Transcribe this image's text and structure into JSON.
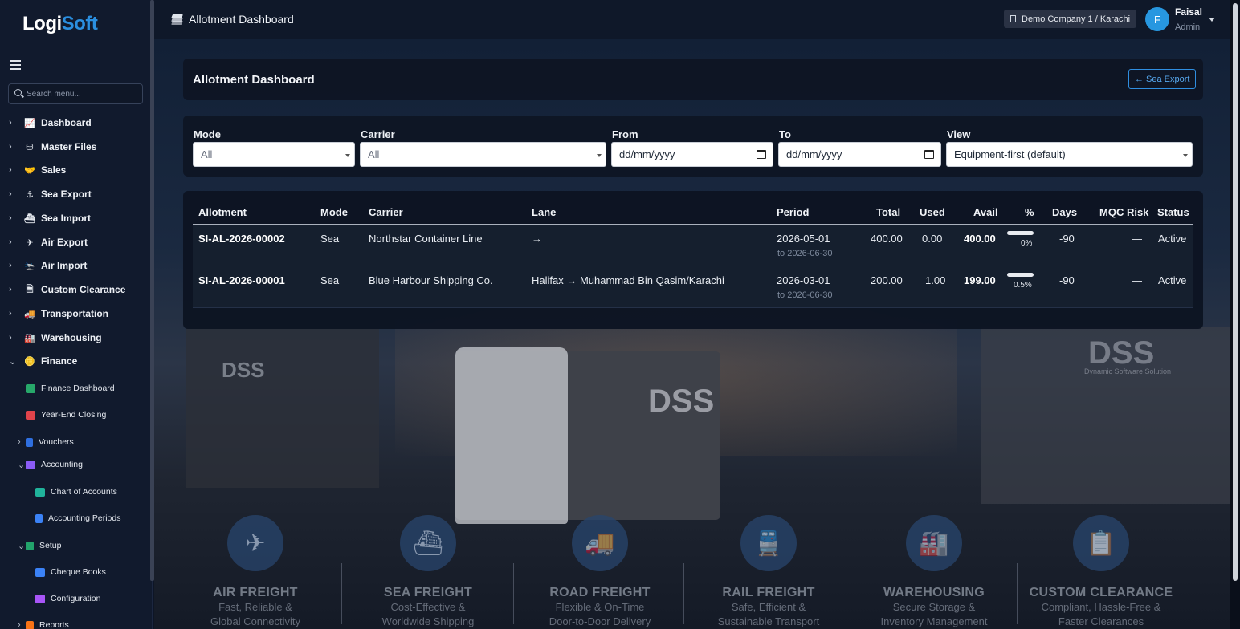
{
  "app": {
    "logo_main": "Logi",
    "logo_accent": "Soft"
  },
  "sidebar": {
    "search_placeholder": "Search menu...",
    "items": [
      {
        "label": "Dashboard",
        "icon": "chart-line-icon"
      },
      {
        "label": "Master Files",
        "icon": "database-icon"
      },
      {
        "label": "Sales",
        "icon": "handshake-icon"
      },
      {
        "label": "Sea Export",
        "icon": "anchor-icon"
      },
      {
        "label": "Sea Import",
        "icon": "ship-icon"
      },
      {
        "label": "Air Export",
        "icon": "plane-icon"
      },
      {
        "label": "Air Import",
        "icon": "plane-arrival-icon"
      },
      {
        "label": "Custom Clearance",
        "icon": "file-shield-icon"
      },
      {
        "label": "Transportation",
        "icon": "truck-icon"
      },
      {
        "label": "Warehousing",
        "icon": "warehouse-icon"
      },
      {
        "label": "Finance",
        "icon": "coins-icon"
      }
    ],
    "finance_children": [
      {
        "label": "Finance Dashboard",
        "color": "#27a86a"
      },
      {
        "label": "Year-End Closing",
        "color": "#e0434b"
      },
      {
        "label": "Vouchers",
        "color": "#2f6fe0"
      },
      {
        "label": "Accounting",
        "color": "#8b5cf6"
      },
      {
        "label": "Chart of Accounts",
        "color": "#20b39b"
      },
      {
        "label": "Accounting Periods",
        "color": "#3b82f6"
      },
      {
        "label": "Setup",
        "color": "#22a36b"
      },
      {
        "label": "Cheque Books",
        "color": "#3b82f6"
      },
      {
        "label": "Configuration",
        "color": "#a855f7"
      },
      {
        "label": "Reports",
        "color": "#f97316"
      }
    ]
  },
  "topbar": {
    "title": "Allotment Dashboard",
    "company": "Demo Company 1 / Karachi",
    "user_initial": "F",
    "user_name": "Faisal",
    "user_role": "Admin"
  },
  "header_card": {
    "title": "Allotment Dashboard",
    "back_button": "← Sea Export"
  },
  "filters": {
    "mode_label": "Mode",
    "mode_value": "All",
    "carrier_label": "Carrier",
    "carrier_value": "All",
    "from_label": "From",
    "from_placeholder": "dd/mm/yyyy",
    "to_label": "To",
    "to_placeholder": "dd/mm/yyyy",
    "view_label": "View",
    "view_value": "Equipment-first (default)"
  },
  "table": {
    "headers": [
      "Allotment",
      "Mode",
      "Carrier",
      "Lane",
      "Period",
      "Total",
      "Used",
      "Avail",
      "%",
      "Days",
      "MQC Risk",
      "Status"
    ],
    "rows": [
      {
        "allotment": "SI-AL-2026-00002",
        "mode": "Sea",
        "carrier": "Northstar Container Line",
        "lane": "→",
        "period_from": "2026-05-01",
        "period_to": "to 2026-06-30",
        "total": "400.00",
        "used": "0.00",
        "avail": "400.00",
        "pct": "0%",
        "pct_value": 0,
        "days": "-90",
        "mqc": "—",
        "status": "Active"
      },
      {
        "allotment": "SI-AL-2026-00001",
        "mode": "Sea",
        "carrier": "Blue Harbour Shipping Co.",
        "lane": "Halifax → Muhammad Bin Qasim/Karachi",
        "period_from": "2026-03-01",
        "period_to": "to 2026-06-30",
        "total": "200.00",
        "used": "1.00",
        "avail": "199.00",
        "pct": "0.5%",
        "pct_value": 0.5,
        "days": "-90",
        "mqc": "—",
        "status": "Active"
      }
    ]
  },
  "background": {
    "dss_left": "DSS",
    "dss_truck": "DSS",
    "dss_right": "DSS",
    "dss_tagline": "Dynamic Software Solution",
    "services": [
      {
        "name": "AIR FREIGHT",
        "line1": "Fast, Reliable &",
        "line2": "Global Connectivity",
        "icon": "plane-icon"
      },
      {
        "name": "SEA FREIGHT",
        "line1": "Cost-Effective &",
        "line2": "Worldwide Shipping",
        "icon": "ship-icon"
      },
      {
        "name": "ROAD FREIGHT",
        "line1": "Flexible & On-Time",
        "line2": "Door-to-Door Delivery",
        "icon": "truck-icon"
      },
      {
        "name": "RAIL FREIGHT",
        "line1": "Safe, Efficient &",
        "line2": "Sustainable Transport",
        "icon": "train-icon"
      },
      {
        "name": "WAREHOUSING",
        "line1": "Secure Storage &",
        "line2": "Inventory Management",
        "icon": "warehouse-icon"
      },
      {
        "name": "CUSTOM CLEARANCE",
        "line1": "Compliant, Hassle-Free &",
        "line2": "Faster Clearances",
        "icon": "clipboard-check-icon"
      }
    ]
  }
}
